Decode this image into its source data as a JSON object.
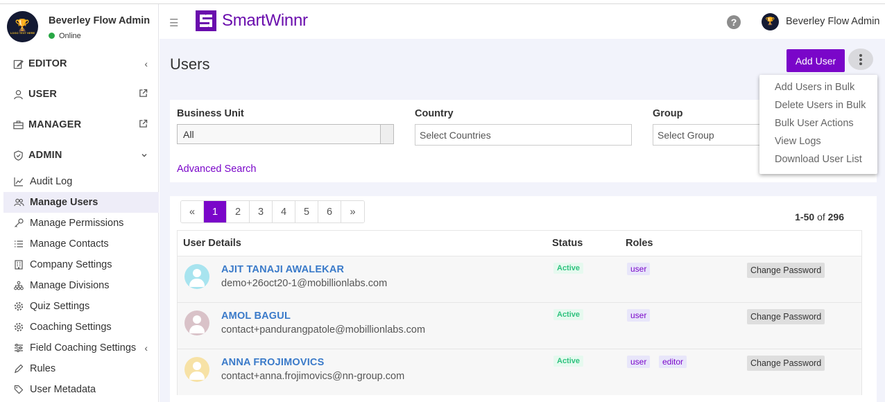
{
  "sidebar": {
    "profile_name": "Beverley Flow Admin",
    "status": "Online",
    "logo_text": "LOGO TEXT HERE",
    "sections": [
      {
        "label": "EDITOR",
        "icon": "edit-icon",
        "indicator": "chevron-left"
      },
      {
        "label": "USER",
        "icon": "user-icon",
        "indicator": "external-link"
      },
      {
        "label": "MANAGER",
        "icon": "briefcase-icon",
        "indicator": "external-link"
      },
      {
        "label": "ADMIN",
        "icon": "shield-icon",
        "indicator": "chevron-down"
      }
    ],
    "admin_items": [
      {
        "label": "Audit Log",
        "icon": "line-chart-icon"
      },
      {
        "label": "Manage Users",
        "icon": "users-icon",
        "active": true
      },
      {
        "label": "Manage Permissions",
        "icon": "key-icon"
      },
      {
        "label": "Manage Contacts",
        "icon": "list-icon"
      },
      {
        "label": "Company Settings",
        "icon": "building-icon"
      },
      {
        "label": "Manage Divisions",
        "icon": "hierarchy-icon"
      },
      {
        "label": "Quiz Settings",
        "icon": "gear-icon"
      },
      {
        "label": "Coaching Settings",
        "icon": "gear-icon"
      },
      {
        "label": "Field Coaching Settings",
        "icon": "sliders-icon",
        "indicator": "chevron-left"
      },
      {
        "label": "Rules",
        "icon": "pen-icon"
      },
      {
        "label": "User Metadata",
        "icon": "tag-icon"
      }
    ]
  },
  "header": {
    "brand": "SmartWinnr",
    "user_name": "Beverley Flow Admin",
    "brand_color": "#6a0dad"
  },
  "main": {
    "title": "Users",
    "add_user_label": "Add User",
    "accent_color": "#7a06c9",
    "filters": {
      "business_unit_label": "Business Unit",
      "business_unit_value": "All",
      "country_label": "Country",
      "country_placeholder": "Select Countries",
      "group_label": "Group",
      "group_placeholder": "Select Group",
      "advanced_search": "Advanced Search"
    },
    "menu": [
      "Add Users in Bulk",
      "Delete Users in Bulk",
      "Bulk User Actions",
      "View Logs",
      "Download User List"
    ],
    "pagination": {
      "prev": "«",
      "pages": [
        "1",
        "2",
        "3",
        "4",
        "5",
        "6"
      ],
      "next": "»",
      "active_page": "1"
    },
    "range": {
      "shown": "1-50",
      "of": "of",
      "total": "296"
    },
    "table": {
      "headers": [
        "User Details",
        "Status",
        "Roles"
      ],
      "rows": [
        {
          "name": "AJIT TANAJI AWALEKAR",
          "email": "demo+26oct20-1@mobillionlabs.com",
          "status": "Active",
          "roles": [
            "user"
          ],
          "action": "Change Password",
          "avatar_color": "#a8e4ef"
        },
        {
          "name": "AMOL BAGUL",
          "email": "contact+pandurangpatole@mobillionlabs.com",
          "status": "Active",
          "roles": [
            "user"
          ],
          "action": "Change Password",
          "avatar_color": "#d9c2c8"
        },
        {
          "name": "ANNA FROJIMOVICS",
          "email": "contact+anna.frojimovics@nn-group.com",
          "status": "Active",
          "roles": [
            "user",
            "editor"
          ],
          "action": "Change Password",
          "avatar_color": "#f7e2a6"
        }
      ]
    }
  }
}
